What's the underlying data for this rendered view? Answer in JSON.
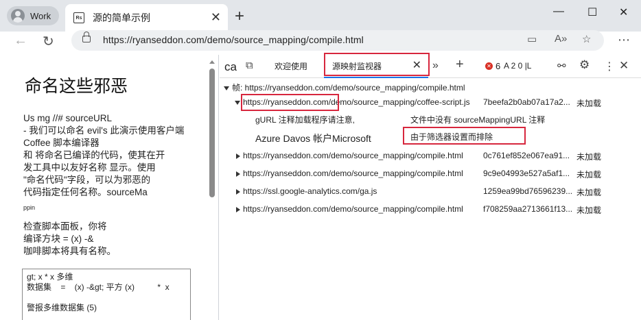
{
  "browser": {
    "profile_label": "Work",
    "tab_title": "源的简单示例",
    "favicon_text": "Rs",
    "url": "https://ryanseddon.com/demo/source_mapping/compile.html"
  },
  "page": {
    "heading": "命名这些邪恶",
    "para1": "Us mg //# sourceURL\n- 我们可以命名 evil's 此演示使用客户端\nCoffee 脚本编译器\n和 将命名已编译的代码，使其在开\n发工具中以友好名称 显示。使用\n\"命名代码\"字段，可以为邪恶的\n代码指定任何名称。sourceMa",
    "para1_tail": "ppin",
    "para2": "检查脚本面板，你将\n编译方块 = (x) -&\n咖啡脚本将具有名称。",
    "code": "gt; x * x 多维\n数据集    =    (x) -&gt; 平方 (x)          *  x\n\n警报多维数据集 (5)"
  },
  "devtools": {
    "panel_prefix": "ca",
    "tab_welcome": "欢迎使用",
    "tab_sourcemaps": "源映射监视器",
    "errors_count": "6",
    "warnings_label": "A 2 0 |L",
    "frame_label": "帧: https://ryanseddon.com/demo/source_mapping/compile.html",
    "rows": [
      {
        "url": "https://ryanseddon.com/demo/source_mapping/coffee-script.js",
        "hash": "7beefa2b0ab07a17a2...",
        "status": "未加载"
      },
      {
        "url": "https://ryanseddon.com/demo/source_mapping/compile.html",
        "hash": "0c761ef852e067ea91...",
        "status": "未加载"
      },
      {
        "url": "https://ryanseddon.com/demo/source_mapping/compile.html",
        "hash": "9c9e04993e527a5af1...",
        "status": "未加载"
      },
      {
        "url": "https://ssl.google-analytics.com/ga.js",
        "hash": "1259ea99bd76596239...",
        "status": "未加载"
      },
      {
        "url": "https://ryanseddon.com/demo/source_mapping/compile.html",
        "hash": "f708259aa2713661f13...",
        "status": "未加载"
      }
    ],
    "expanded": {
      "note1": "gURL 注释加载程序请注意,",
      "note2": "文件中没有 sourceMappingURL 注释",
      "account": "Azure Davos 帐户Microsoft",
      "excluded": "由于筛选器设置而排除"
    }
  }
}
